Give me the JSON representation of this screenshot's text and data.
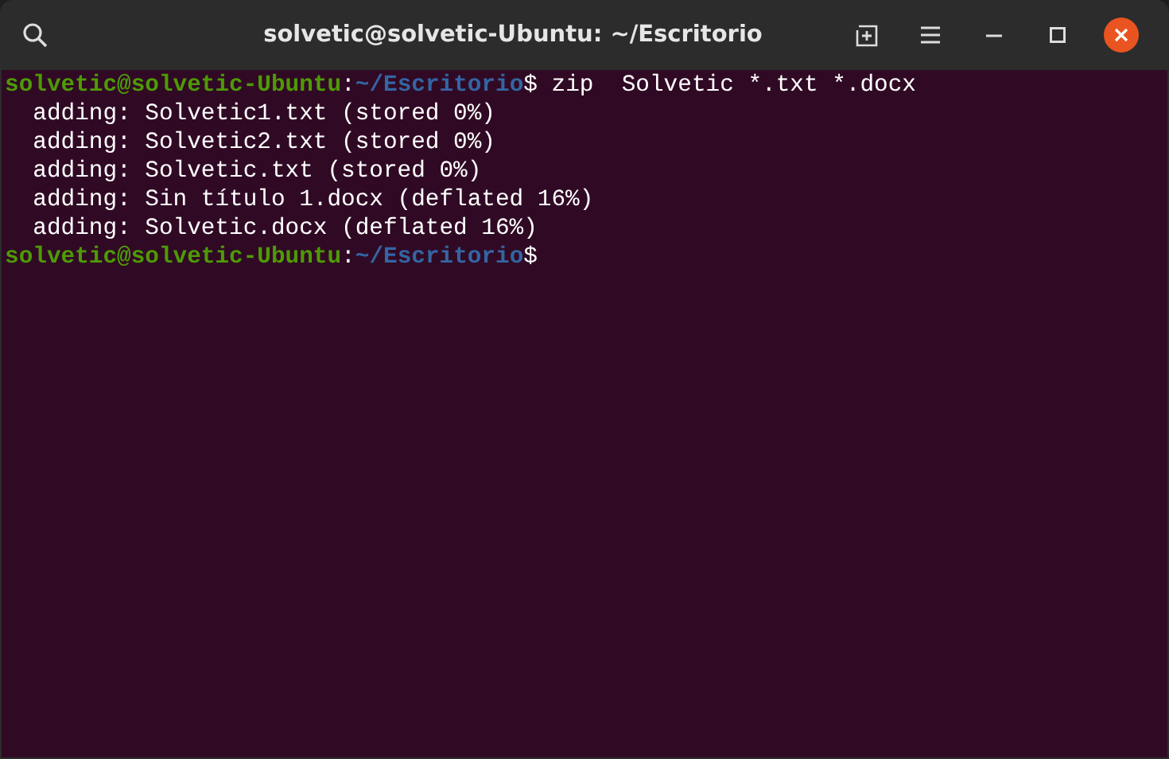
{
  "window": {
    "title": "solvetic@solvetic-Ubuntu: ~/Escritorio"
  },
  "terminal": {
    "lines": [
      {
        "kind": "prompt",
        "user": "solvetic@solvetic-Ubuntu",
        "separator": ":",
        "path": "~/Escritorio",
        "symbol": "$",
        "command": " zip  Solvetic *.txt *.docx"
      },
      {
        "kind": "output",
        "text": "  adding: Solvetic1.txt (stored 0%)"
      },
      {
        "kind": "output",
        "text": "  adding: Solvetic2.txt (stored 0%)"
      },
      {
        "kind": "output",
        "text": "  adding: Solvetic.txt (stored 0%)"
      },
      {
        "kind": "output",
        "text": "  adding: Sin título 1.docx (deflated 16%)"
      },
      {
        "kind": "output",
        "text": "  adding: Solvetic.docx (deflated 16%)"
      },
      {
        "kind": "prompt",
        "user": "solvetic@solvetic-Ubuntu",
        "separator": ":",
        "path": "~/Escritorio",
        "symbol": "$"
      }
    ]
  }
}
